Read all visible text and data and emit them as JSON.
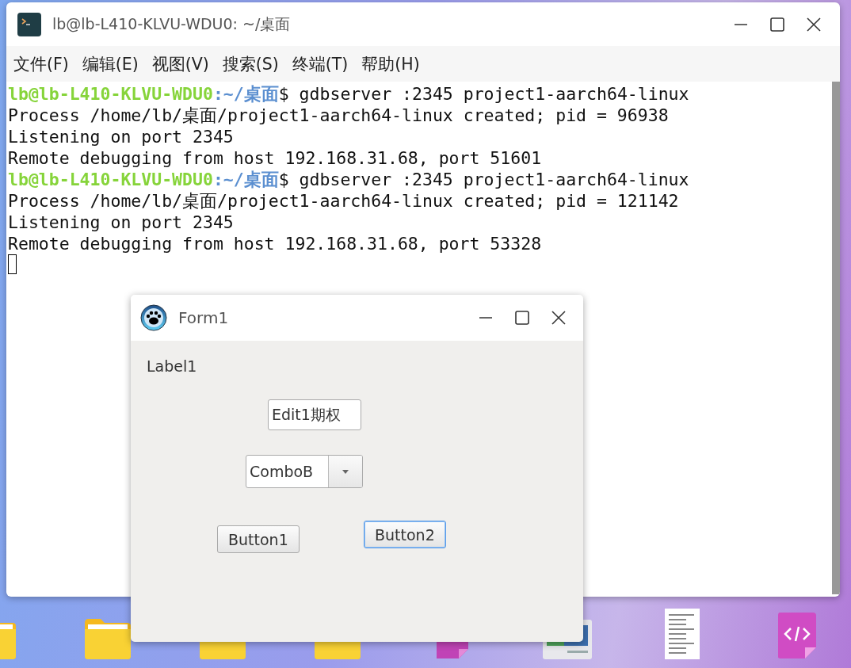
{
  "desktop_icons": [
    {
      "kind": "folder"
    },
    {
      "kind": "folder"
    },
    {
      "kind": "folder"
    },
    {
      "kind": "folder"
    },
    {
      "kind": "pink-file"
    },
    {
      "kind": "image-file"
    },
    {
      "kind": "text-file"
    },
    {
      "kind": "code-file"
    }
  ],
  "terminal": {
    "title": "lb@lb-L410-KLVU-WDU0: ~/桌面",
    "menu": [
      "文件(F)",
      "编辑(E)",
      "视图(V)",
      "搜索(S)",
      "终端(T)",
      "帮助(H)"
    ],
    "lines": [
      {
        "kind": "prompt",
        "user": "lb@lb-L410-KLVU-WDU0",
        "path": ":~/桌面",
        "command": "$ gdbserver :2345 project1-aarch64-linux"
      },
      {
        "kind": "output",
        "text": "Process /home/lb/桌面/project1-aarch64-linux created; pid = 96938"
      },
      {
        "kind": "output",
        "text": "Listening on port 2345"
      },
      {
        "kind": "output",
        "text": "Remote debugging from host 192.168.31.68, port 51601"
      },
      {
        "kind": "prompt",
        "user": "lb@lb-L410-KLVU-WDU0",
        "path": ":~/桌面",
        "command": "$ gdbserver :2345 project1-aarch64-linux"
      },
      {
        "kind": "output",
        "text": "Process /home/lb/桌面/project1-aarch64-linux created; pid = 121142"
      },
      {
        "kind": "output",
        "text": "Listening on port 2345"
      },
      {
        "kind": "output",
        "text": "Remote debugging from host 192.168.31.68, port 53328"
      },
      {
        "kind": "cursor"
      }
    ]
  },
  "form": {
    "title": "Form1",
    "label": "Label1",
    "edit": {
      "value": "Edit1期权"
    },
    "combo": {
      "value": "ComboB"
    },
    "buttons": [
      {
        "label": "Button1",
        "focused": false
      },
      {
        "label": "Button2",
        "focused": true
      }
    ]
  }
}
